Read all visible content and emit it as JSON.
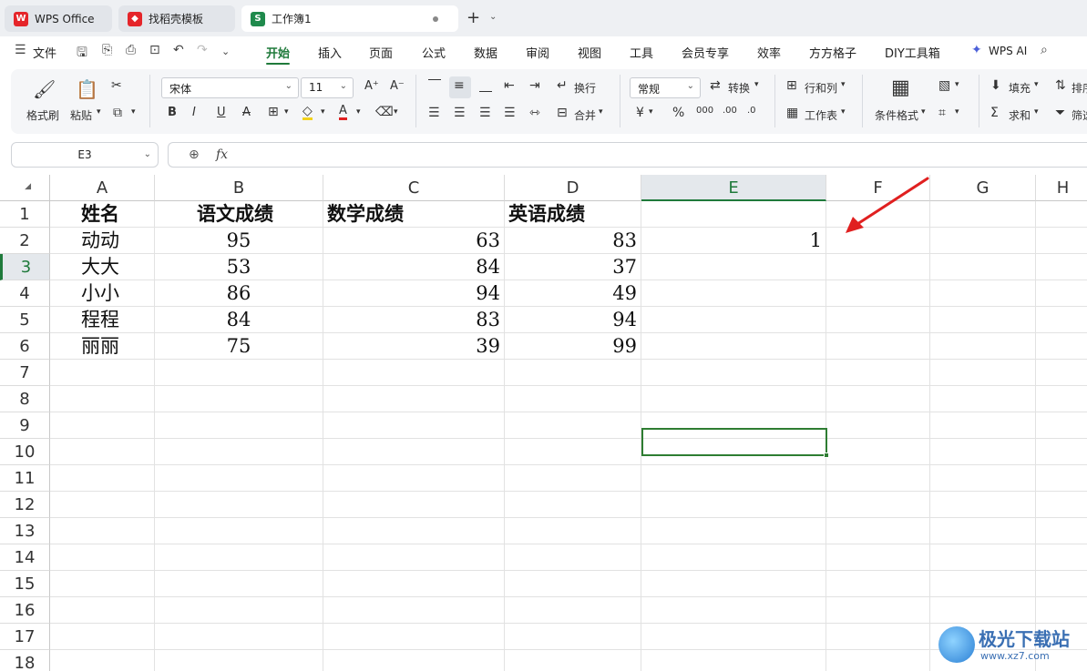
{
  "tabs": [
    {
      "label": "WPS Office",
      "icon": "wps-logo-icon",
      "active": false
    },
    {
      "label": "找稻壳模板",
      "icon": "docer-icon",
      "active": false
    },
    {
      "label": "工作簿1",
      "icon": "sheet-s-icon",
      "active": true
    }
  ],
  "menu": {
    "file": "文件",
    "items": [
      "开始",
      "插入",
      "页面",
      "公式",
      "数据",
      "审阅",
      "视图",
      "工具",
      "会员专享",
      "效率",
      "方方格子",
      "DIY工具箱"
    ],
    "active": "开始",
    "wps_ai": "WPS AI"
  },
  "ribbon": {
    "format_painter": "格式刷",
    "paste": "粘贴",
    "font_name": "宋体",
    "font_size": "11",
    "wrap": "换行",
    "merge": "合并",
    "number_format": "常规",
    "convert": "转换",
    "rows_cols": "行和列",
    "worksheet": "工作表",
    "cond_format": "条件格式",
    "fill": "填充",
    "sum": "求和",
    "sort": "排序",
    "filter": "筛选"
  },
  "formula_bar": {
    "cell_ref": "E3",
    "fx": "fx",
    "content": ""
  },
  "sheet": {
    "columns": [
      "A",
      "B",
      "C",
      "D",
      "E",
      "F",
      "G",
      "H"
    ],
    "selected_column": "E",
    "selected_row": "3",
    "rows": [
      "1",
      "2",
      "3",
      "4",
      "5",
      "6",
      "7",
      "8",
      "9",
      "10",
      "11",
      "12",
      "13",
      "14",
      "15",
      "16",
      "17",
      "18"
    ],
    "header": [
      "姓名",
      "语文成绩",
      "数学成绩",
      "英语成绩"
    ],
    "data": [
      [
        "动动",
        "95",
        "63",
        "83",
        "1"
      ],
      [
        "大大",
        "53",
        "84",
        "37",
        ""
      ],
      [
        "小小",
        "86",
        "94",
        "49",
        ""
      ],
      [
        "程程",
        "84",
        "83",
        "94",
        ""
      ],
      [
        "丽丽",
        "75",
        "39",
        "99",
        ""
      ]
    ]
  },
  "watermark": {
    "name": "极光下载站",
    "url": "www.xz7.com"
  },
  "colors": {
    "accent": "#1f7a3b",
    "arrow": "#e02020"
  }
}
